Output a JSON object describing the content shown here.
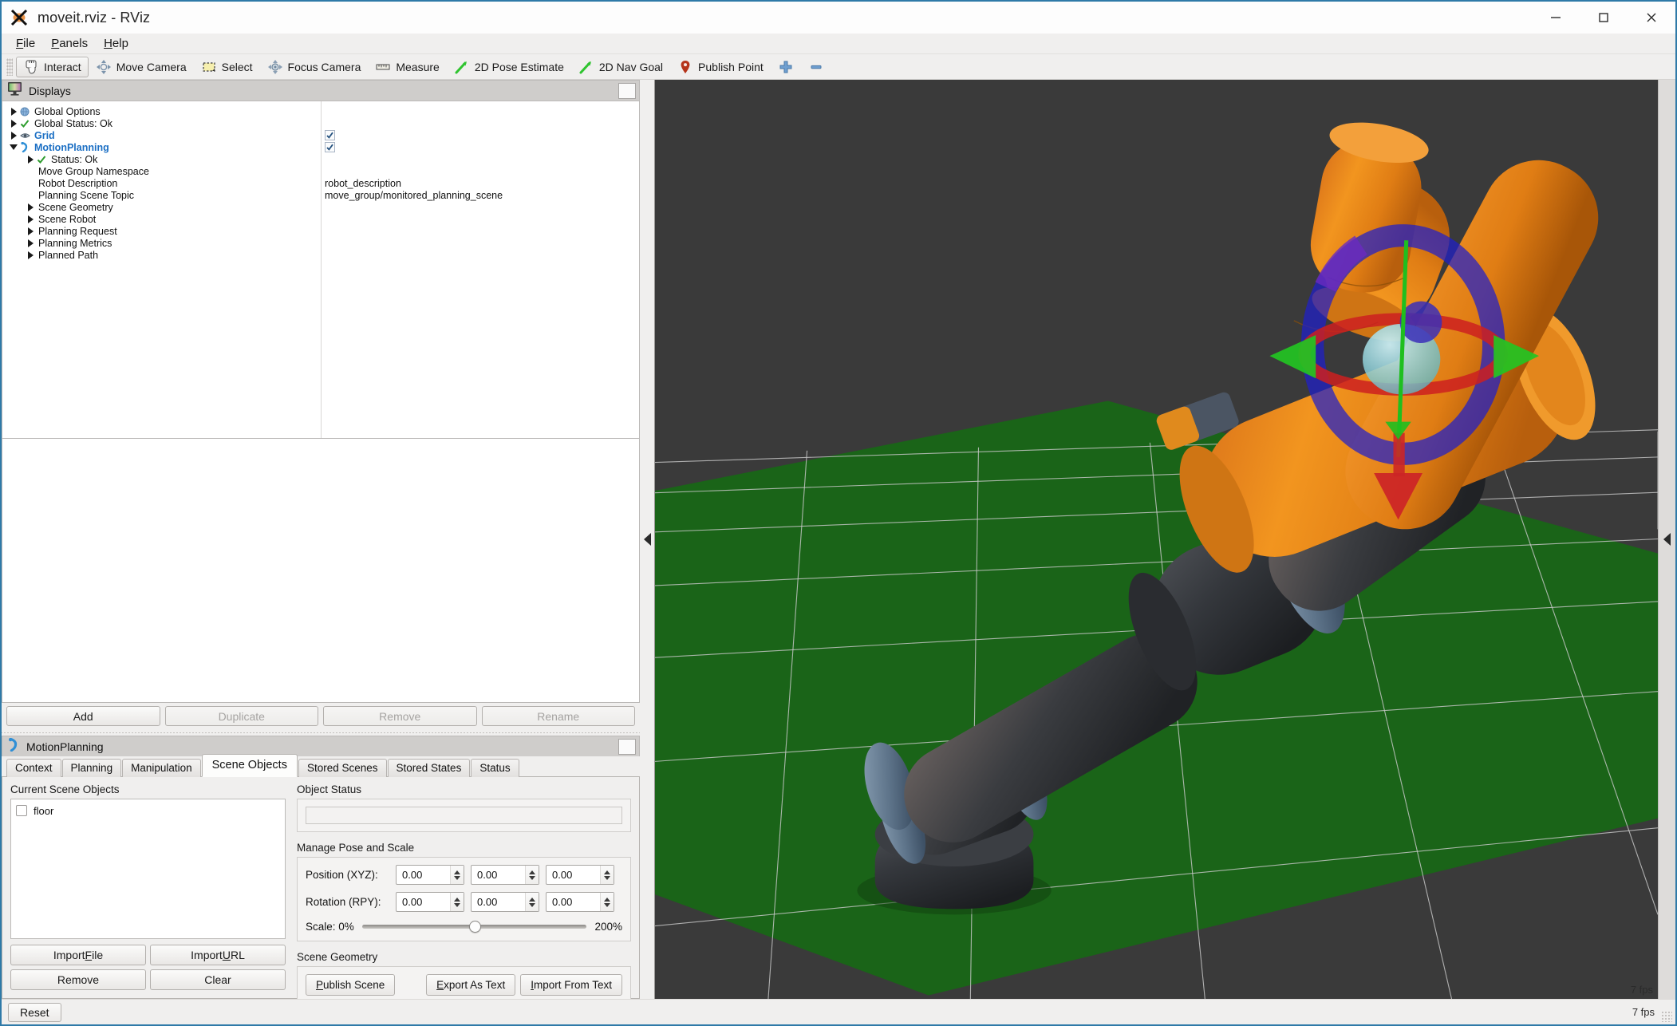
{
  "window": {
    "title": "moveit.rviz - RViz",
    "app_icon": "rviz-x-icon",
    "minimize_label": "—",
    "maximize_label": "□",
    "close_label": "✕"
  },
  "menubar": {
    "items": [
      {
        "label": "File",
        "mnemonic": "F"
      },
      {
        "label": "Panels",
        "mnemonic": "P"
      },
      {
        "label": "Help",
        "mnemonic": "H"
      }
    ]
  },
  "toolbar": {
    "items": [
      {
        "label": "Interact",
        "icon": "hand-cursor-icon",
        "active": true
      },
      {
        "label": "Move Camera",
        "icon": "move-camera-icon",
        "active": false
      },
      {
        "label": "Select",
        "icon": "select-rect-icon",
        "active": false
      },
      {
        "label": "Focus Camera",
        "icon": "focus-camera-icon",
        "active": false
      },
      {
        "label": "Measure",
        "icon": "ruler-icon",
        "active": false
      },
      {
        "label": "2D Pose Estimate",
        "icon": "green-arrow-icon",
        "active": false
      },
      {
        "label": "2D Nav Goal",
        "icon": "green-arrow-icon",
        "active": false
      },
      {
        "label": "Publish Point",
        "icon": "map-pin-icon",
        "active": false
      },
      {
        "label": "",
        "icon": "plus-icon",
        "active": false
      },
      {
        "label": "",
        "icon": "minus-icon",
        "active": false
      }
    ]
  },
  "displays_panel": {
    "title": "Displays",
    "icon": "displays-monitor-icon",
    "tree": [
      {
        "label": "Global Options",
        "indent": 0,
        "twisty": "closed",
        "icon": "globe-icon",
        "blue": false,
        "value": ""
      },
      {
        "label": "Global Status: Ok",
        "indent": 0,
        "twisty": "closed",
        "icon": "check-icon",
        "blue": false,
        "value": ""
      },
      {
        "label": "Grid",
        "indent": 0,
        "twisty": "closed",
        "icon": "grid-eye-icon",
        "blue": true,
        "value": "",
        "checkbox": true
      },
      {
        "label": "MotionPlanning",
        "indent": 0,
        "twisty": "open",
        "icon": "motionplanning-icon",
        "blue": true,
        "value": "",
        "checkbox": true
      },
      {
        "label": "Status: Ok",
        "indent": 1,
        "twisty": "closed",
        "icon": "check-icon",
        "blue": false,
        "value": ""
      },
      {
        "label": "Move Group Namespace",
        "indent": 1,
        "twisty": "none",
        "icon": "none",
        "blue": false,
        "value": ""
      },
      {
        "label": "Robot Description",
        "indent": 1,
        "twisty": "none",
        "icon": "none",
        "blue": false,
        "value": "robot_description"
      },
      {
        "label": "Planning Scene Topic",
        "indent": 1,
        "twisty": "none",
        "icon": "none",
        "blue": false,
        "value": "move_group/monitored_planning_scene"
      },
      {
        "label": "Scene Geometry",
        "indent": 1,
        "twisty": "closed",
        "icon": "none",
        "blue": false,
        "value": ""
      },
      {
        "label": "Scene Robot",
        "indent": 1,
        "twisty": "closed",
        "icon": "none",
        "blue": false,
        "value": ""
      },
      {
        "label": "Planning Request",
        "indent": 1,
        "twisty": "closed",
        "icon": "none",
        "blue": false,
        "value": ""
      },
      {
        "label": "Planning Metrics",
        "indent": 1,
        "twisty": "closed",
        "icon": "none",
        "blue": false,
        "value": ""
      },
      {
        "label": "Planned Path",
        "indent": 1,
        "twisty": "closed",
        "icon": "none",
        "blue": false,
        "value": ""
      }
    ],
    "buttons": [
      {
        "label": "Add",
        "enabled": true
      },
      {
        "label": "Duplicate",
        "enabled": false
      },
      {
        "label": "Remove",
        "enabled": false
      },
      {
        "label": "Rename",
        "enabled": false
      }
    ]
  },
  "motion_planning_panel": {
    "title": "MotionPlanning",
    "icon": "motionplanning-icon",
    "tabs": [
      {
        "label": "Context",
        "active": false
      },
      {
        "label": "Planning",
        "active": false
      },
      {
        "label": "Manipulation",
        "active": false
      },
      {
        "label": "Scene Objects",
        "active": true
      },
      {
        "label": "Stored Scenes",
        "active": false
      },
      {
        "label": "Stored States",
        "active": false
      },
      {
        "label": "Status",
        "active": false
      }
    ],
    "scene_objects": {
      "current_objects_label": "Current Scene Objects",
      "objects": [
        {
          "name": "floor",
          "checked": false
        }
      ],
      "list_buttons": [
        {
          "label": "Import File",
          "mnemonic": "F"
        },
        {
          "label": "Import URL",
          "mnemonic": "U"
        },
        {
          "label": "Remove",
          "mnemonic": ""
        },
        {
          "label": "Clear",
          "mnemonic": ""
        }
      ],
      "object_status_label": "Object Status",
      "object_status_value": "",
      "manage_pose_label": "Manage Pose and Scale",
      "position_label": "Position (XYZ):",
      "position_values": [
        "0.00",
        "0.00",
        "0.00"
      ],
      "rotation_label": "Rotation (RPY):",
      "rotation_values": [
        "0.00",
        "0.00",
        "0.00"
      ],
      "scale_label": "Scale:",
      "scale_min_label": "0%",
      "scale_max_label": "200%",
      "scale_percent": 50,
      "scene_geometry_label": "Scene Geometry",
      "geometry_buttons": [
        {
          "label": "Publish Scene",
          "mnemonic": "P"
        },
        {
          "label": "Export As Text",
          "mnemonic": "E"
        },
        {
          "label": "Import From Text",
          "mnemonic": "I"
        }
      ]
    }
  },
  "viewport": {
    "fps_label": "7 fps",
    "background_color": "#3a3a3a",
    "ground_plane_color": "#1a6418",
    "grid_color": "#c8c8c8",
    "robot_upper_color": "#e8871b",
    "robot_lower_color": "#2e3136",
    "robot_joint_color": "#5d7389",
    "marker_ring_color": "#2222cc",
    "marker_ring2_color": "#cc2222",
    "marker_arrow_green": "#22bb22",
    "marker_arrow_red": "#cc2222",
    "marker_sphere_color": "#7fd4d4",
    "collapse_left_icon": "collapse-left-arrow-icon",
    "collapse_right_icon": "collapse-left-arrow-icon"
  },
  "statusbar": {
    "reset_label": "Reset",
    "fps_label": "7 fps"
  }
}
